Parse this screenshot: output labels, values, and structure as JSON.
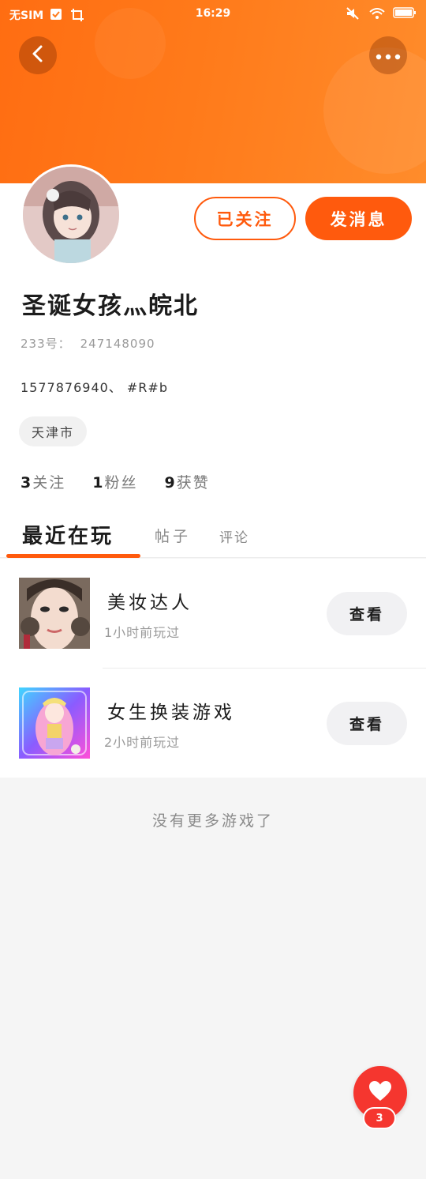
{
  "status_bar": {
    "carrier": "无SIM",
    "time": "16:29"
  },
  "profile": {
    "nickname": "圣诞女孩灬皖北",
    "uid_label": "233号：",
    "uid": "247148090",
    "bio": "1577876940、 #R#b",
    "location": "天津市",
    "follow_label": "已关注",
    "message_label": "发消息"
  },
  "stats": [
    {
      "num": "3",
      "label": "关注"
    },
    {
      "num": "1",
      "label": "粉丝"
    },
    {
      "num": "9",
      "label": "获赞"
    }
  ],
  "tabs": {
    "recent": "最近在玩",
    "posts": "帖子",
    "comments": "评论"
  },
  "games": [
    {
      "title": "美妆达人",
      "subtitle": "1小时前玩过",
      "button": "查看"
    },
    {
      "title": "女生换装游戏",
      "subtitle": "2小时前玩过",
      "button": "查看"
    }
  ],
  "footer_note": "没有更多游戏了",
  "like": {
    "count": "3"
  },
  "colors": {
    "accent": "#ff5a0d",
    "header_start": "#ff6d12",
    "header_end": "#ff8c2b",
    "like_red": "#f5362f"
  }
}
